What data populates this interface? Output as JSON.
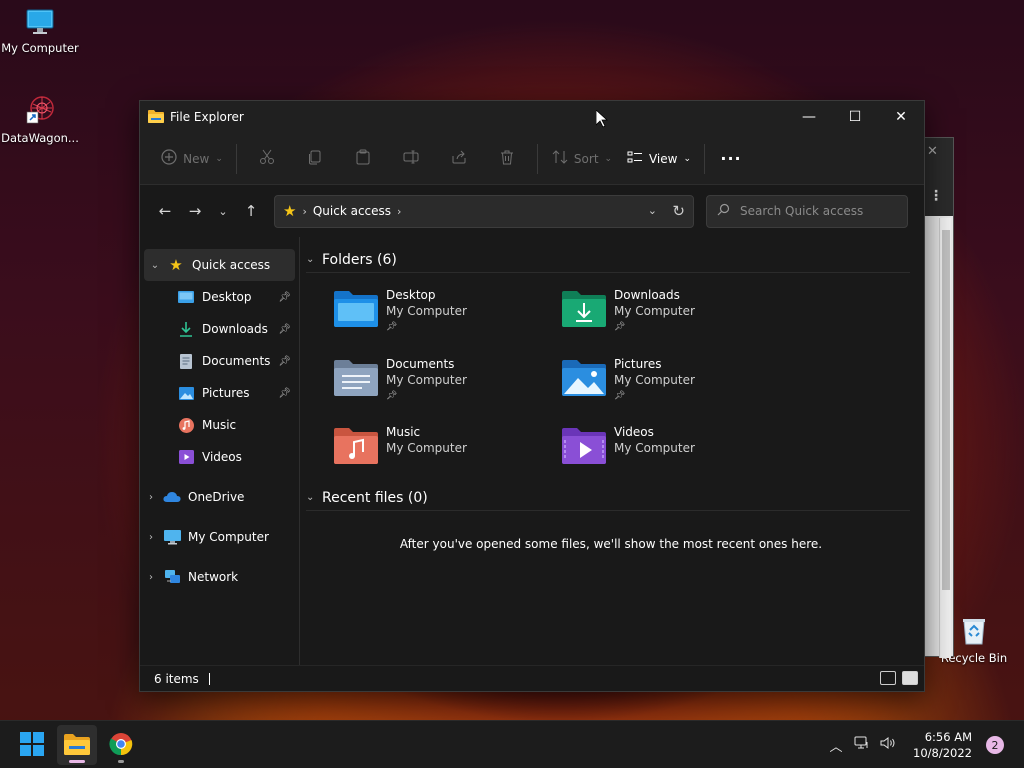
{
  "desktop": {
    "icons": [
      {
        "label": "My Computer",
        "icon": "monitor-icon"
      },
      {
        "label": "DataWagon...",
        "icon": "datawagon-shortcut-icon"
      },
      {
        "label": "Recycle Bin",
        "icon": "recycle-bin-icon"
      }
    ]
  },
  "window": {
    "title": "File Explorer",
    "controls": {
      "minimize": "—",
      "maximize": "☐",
      "close": "✕"
    }
  },
  "toolbar": {
    "new_label": "New",
    "sort_label": "Sort",
    "view_label": "View",
    "more_label": "···"
  },
  "address": {
    "location": "Quick access",
    "search_placeholder": "Search Quick access"
  },
  "sidebar": {
    "quick_access": "Quick access",
    "pinned": [
      {
        "label": "Desktop",
        "pinned": true
      },
      {
        "label": "Downloads",
        "pinned": true
      },
      {
        "label": "Documents",
        "pinned": true
      },
      {
        "label": "Pictures",
        "pinned": true
      },
      {
        "label": "Music",
        "pinned": false
      },
      {
        "label": "Videos",
        "pinned": false
      }
    ],
    "roots": [
      {
        "label": "OneDrive"
      },
      {
        "label": "My Computer"
      },
      {
        "label": "Network"
      }
    ]
  },
  "main": {
    "folders_header": "Folders (6)",
    "folders": [
      {
        "name": "Desktop",
        "location": "My Computer",
        "pinned": true,
        "color": "#1e90e8"
      },
      {
        "name": "Downloads",
        "location": "My Computer",
        "pinned": true,
        "color": "#19a974"
      },
      {
        "name": "Documents",
        "location": "My Computer",
        "pinned": true,
        "color": "#8fa4bf"
      },
      {
        "name": "Pictures",
        "location": "My Computer",
        "pinned": true,
        "color": "#2b8ee0"
      },
      {
        "name": "Music",
        "location": "My Computer",
        "pinned": false,
        "color": "#e8735f"
      },
      {
        "name": "Videos",
        "location": "My Computer",
        "pinned": false,
        "color": "#8a4fd6"
      }
    ],
    "recent_header": "Recent files (0)",
    "recent_empty": "After you've opened some files, we'll show the most recent ones here."
  },
  "status": {
    "items": "6 items"
  },
  "taskbar": {
    "time": "6:56 AM",
    "date": "10/8/2022",
    "notifications": "2",
    "accent": "#e8b8e6"
  }
}
